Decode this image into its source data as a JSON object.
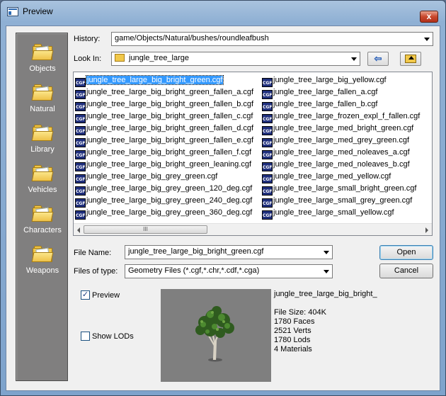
{
  "window": {
    "title": "Preview",
    "close_label": "x"
  },
  "places": [
    {
      "label": "Objects"
    },
    {
      "label": "Natural"
    },
    {
      "label": "Library"
    },
    {
      "label": "Vehicles"
    },
    {
      "label": "Characters"
    },
    {
      "label": "Weapons"
    }
  ],
  "history": {
    "label": "History:",
    "value": "game/Objects/Natural/bushes/roundleafbush"
  },
  "lookin": {
    "label": "Look In:",
    "value": "jungle_tree_large"
  },
  "files_left": [
    "jungle_tree_large_big_bright_green.cgf",
    "jungle_tree_large_big_bright_green_fallen_a.cgf",
    "jungle_tree_large_big_bright_green_fallen_b.cgf",
    "jungle_tree_large_big_bright_green_fallen_c.cgf",
    "jungle_tree_large_big_bright_green_fallen_d.cgf",
    "jungle_tree_large_big_bright_green_fallen_e.cgf",
    "jungle_tree_large_big_bright_green_fallen_f.cgf",
    "jungle_tree_large_big_bright_green_leaning.cgf",
    "jungle_tree_large_big_grey_green.cgf",
    "jungle_tree_large_big_grey_green_120_deg.cgf",
    "jungle_tree_large_big_grey_green_240_deg.cgf",
    "jungle_tree_large_big_grey_green_360_deg.cgf"
  ],
  "files_right": [
    "jungle_tree_large_big_yellow.cgf",
    "jungle_tree_large_fallen_a.cgf",
    "jungle_tree_large_fallen_b.cgf",
    "jungle_tree_large_frozen_expl_f_fallen.cgf",
    "jungle_tree_large_med_bright_green.cgf",
    "jungle_tree_large_med_grey_green.cgf",
    "jungle_tree_large_med_noleaves_a.cgf",
    "jungle_tree_large_med_noleaves_b.cgf",
    "jungle_tree_large_med_yellow.cgf",
    "jungle_tree_large_small_bright_green.cgf",
    "jungle_tree_large_small_grey_green.cgf",
    "jungle_tree_large_small_yellow.cgf"
  ],
  "file_icon_text": "CGF",
  "scroll_thumb_grip": "III",
  "filename": {
    "label": "File Name:",
    "value": "jungle_tree_large_big_bright_green.cgf"
  },
  "filetype": {
    "label": "Files of type:",
    "value": "Geometry Files (*.cgf,*.chr,*.cdf,*.cga)"
  },
  "buttons": {
    "open": "Open",
    "cancel": "Cancel"
  },
  "options": {
    "preview_label": "Preview",
    "preview_checked": true,
    "show_lods_label": "Show LODs",
    "show_lods_checked": false,
    "check_mark": "✓"
  },
  "info": {
    "name": "jungle_tree_large_big_bright_",
    "file_size": "File Size: 404K",
    "faces": "1780 Faces",
    "verts": "2521 Verts",
    "lods": "1780 Lods",
    "materials": "4 Materials"
  },
  "colors": {
    "selection": "#3399ff",
    "places_bg": "#807f7f",
    "preview_bg": "#7f7f7f"
  }
}
